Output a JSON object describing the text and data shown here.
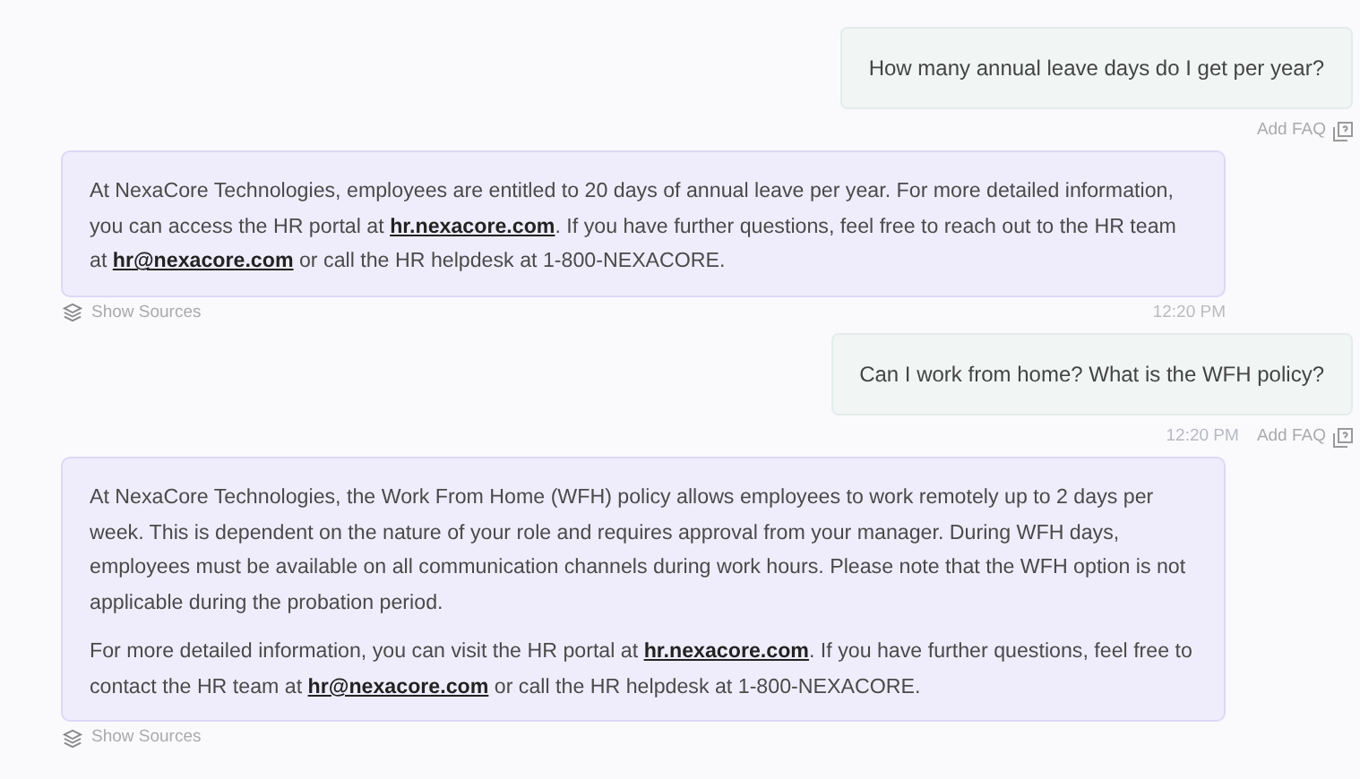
{
  "messages": [
    {
      "kind": "user",
      "text": "How many annual leave days do I get per year?",
      "add_faq": "Add FAQ"
    },
    {
      "kind": "bot",
      "paragraphs": [
        "At NexaCore Technologies, employees are entitled to 20 days of annual leave per year. For more detailed information, you can access the HR portal at **hr.nexacore.com**. If you have further questions, feel free to reach out to the HR team at **hr@nexacore.com** or call the HR helpdesk at 1-800-NEXACORE."
      ],
      "sources": "Show Sources",
      "time": "12:20 PM"
    },
    {
      "kind": "user",
      "text": "Can I work from home? What is the WFH policy?",
      "time": "12:20 PM",
      "add_faq": "Add FAQ"
    },
    {
      "kind": "bot",
      "paragraphs": [
        "At NexaCore Technologies, the Work From Home (WFH) policy allows employees to work remotely up to 2 days per week. This is dependent on the nature of your role and requires approval from your manager. During WFH days, employees must be available on all communication channels during work hours. Please note that the WFH option is not applicable during the probation period.",
        "For more detailed information, you can visit the HR portal at **hr.nexacore.com**. If you have further questions, feel free to contact the HR team at **hr@nexacore.com** or call the HR helpdesk at 1-800-NEXACORE."
      ],
      "sources": "Show Sources"
    }
  ]
}
